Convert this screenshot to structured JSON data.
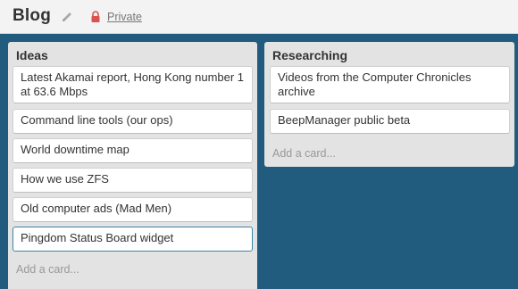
{
  "header": {
    "board_title": "Blog",
    "privacy_label": "Private",
    "icons": [
      "edit-icon",
      "lock-icon"
    ]
  },
  "lists": [
    {
      "title": "Ideas",
      "cards": [
        "Latest Akamai report, Hong Kong number 1 at 63.6 Mbps",
        "Command line tools (our ops)",
        "World downtime map",
        "How we use ZFS",
        "Old computer ads (Mad Men)",
        "Pingdom Status Board widget"
      ],
      "add_card_label": "Add a card..."
    },
    {
      "title": "Researching",
      "cards": [
        "Videos from the Computer Chronicles archive",
        "BeepManager public beta"
      ],
      "add_card_label": "Add a card..."
    }
  ],
  "colors": {
    "board_background": "#215c7e",
    "list_background": "#e3e3e3",
    "active_card_border": "#3b86a8"
  }
}
